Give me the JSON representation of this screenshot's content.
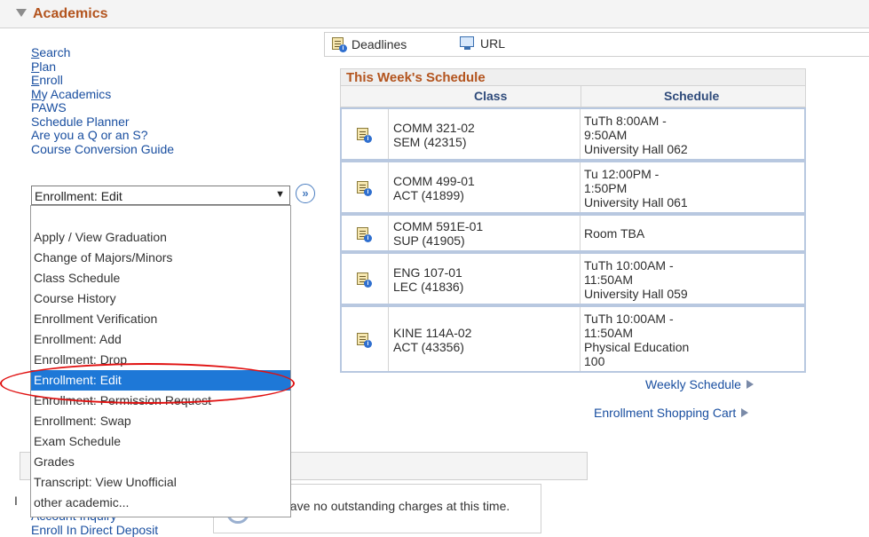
{
  "section": {
    "title": "Academics"
  },
  "nav": {
    "links": [
      {
        "label": "Search",
        "accel": "S",
        "rest": "earch"
      },
      {
        "label": "Plan",
        "accel": "P",
        "rest": "lan"
      },
      {
        "label": "Enroll",
        "accel": "E",
        "rest": "nroll"
      },
      {
        "label": "My Academics",
        "accel": "M",
        "rest": "y Academics"
      },
      {
        "label": "PAWS",
        "accel": "",
        "rest": "PAWS"
      },
      {
        "label": "Schedule Planner",
        "accel": "",
        "rest": "Schedule Planner"
      },
      {
        "label": "Are you a Q or an S?",
        "accel": "",
        "rest": "Are you a Q or an S?"
      },
      {
        "label": "Course Conversion Guide",
        "accel": "",
        "rest": "Course Conversion Guide"
      }
    ]
  },
  "select": {
    "value": "Enrollment: Edit",
    "caret": "▼",
    "go_glyph": "»"
  },
  "dropdown": {
    "items": [
      "Apply / View Graduation",
      "Change of Majors/Minors",
      "Class Schedule",
      "Course History",
      "Enrollment Verification",
      "Enrollment: Add",
      "Enrollment: Drop",
      "Enrollment: Edit",
      "Enrollment: Permission Request",
      "Enrollment: Swap",
      "Exam Schedule",
      "Grades",
      "Transcript: View Unofficial",
      "other academic..."
    ],
    "selected": "Enrollment: Edit"
  },
  "toolbar": {
    "deadlines": "Deadlines",
    "url": "URL"
  },
  "schedule": {
    "title": "This Week's Schedule",
    "col_class": "Class",
    "col_schedule": "Schedule",
    "rows": [
      {
        "class1": "COMM 321-02",
        "class2": "SEM (42315)",
        "s1": "TuTh 8:00AM -",
        "s2": "9:50AM",
        "s3": "University Hall 062",
        "s4": ""
      },
      {
        "class1": "COMM 499-01",
        "class2": "ACT (41899)",
        "s1": "Tu 12:00PM -",
        "s2": "1:50PM",
        "s3": "University Hall 061",
        "s4": ""
      },
      {
        "class1": "COMM 591E-01",
        "class2": "SUP (41905)",
        "s1": "Room  TBA",
        "s2": "",
        "s3": "",
        "s4": ""
      },
      {
        "class1": "ENG 107-01",
        "class2": "LEC (41836)",
        "s1": "TuTh 10:00AM -",
        "s2": "11:50AM",
        "s3": "University Hall 059",
        "s4": ""
      },
      {
        "class1": "KINE 114A-02",
        "class2": "ACT (43356)",
        "s1": "TuTh 10:00AM -",
        "s2": "11:50AM",
        "s3": "Physical Education",
        "s4": "100"
      }
    ],
    "weekly_link": "Weekly Schedule",
    "cart_link": "Enrollment Shopping Cart"
  },
  "finances": {
    "message": "have no outstanding charges at this time.",
    "links": [
      "Account Inquiry",
      "Enroll In Direct Deposit"
    ]
  }
}
